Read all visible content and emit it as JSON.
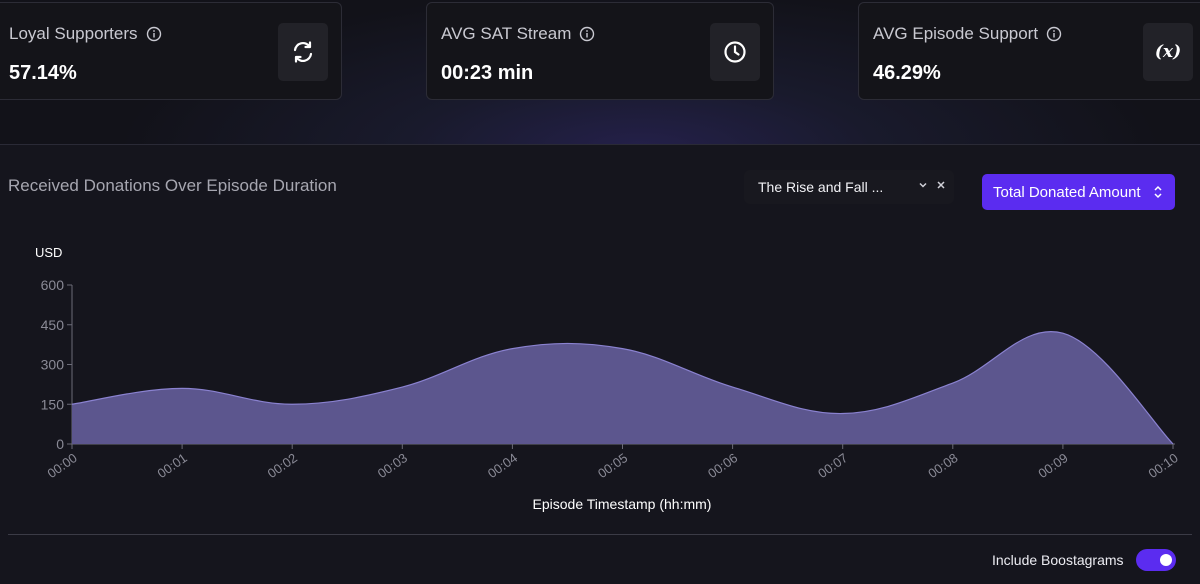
{
  "stats": [
    {
      "label": "Loyal Supporters",
      "value": "57.14%",
      "icon": "refresh-icon"
    },
    {
      "label": "AVG SAT Stream",
      "value": "00:23 min",
      "icon": "clock-icon"
    },
    {
      "label": "AVG Episode Support",
      "value": "46.29%",
      "icon": "function-icon"
    }
  ],
  "panel": {
    "title": "Received Donations Over Episode Duration",
    "episode_select": "The Rise and Fall ...",
    "metric_select": "Total Donated Amount",
    "include_boostagrams_label": "Include Boostagrams",
    "include_boostagrams_on": true
  },
  "colors": {
    "accent": "#5b2cf0",
    "area_fill": "#5c568e",
    "area_stroke": "#8a82d0"
  },
  "chart_data": {
    "type": "area",
    "ylabel": "USD",
    "xlabel": "Episode Timestamp (hh:mm)",
    "x": [
      "00:00",
      "00:01",
      "00:02",
      "00:03",
      "00:04",
      "00:05",
      "00:06",
      "00:07",
      "00:08",
      "00:09",
      "00:10"
    ],
    "values": [
      150,
      210,
      150,
      215,
      360,
      360,
      215,
      115,
      230,
      418,
      0
    ],
    "yticks": [
      0,
      150,
      300,
      450,
      600
    ],
    "ylim": [
      0,
      600
    ],
    "grid": false
  }
}
